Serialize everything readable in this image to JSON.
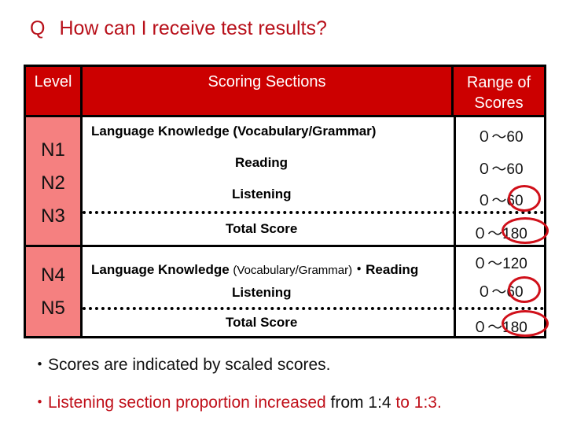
{
  "title": {
    "prefix": "Q",
    "text": "How can I receive test results?"
  },
  "table": {
    "headers": {
      "level": "Level",
      "sections": "Scoring Sections",
      "range_line1": "Range of",
      "range_line2": "Scores"
    },
    "groups": [
      {
        "levels": [
          "N1",
          "N2",
          "N3"
        ],
        "rows": [
          {
            "section": "Language Knowledge (Vocabulary/Grammar)",
            "range": "０～60",
            "circled": false
          },
          {
            "section": "Reading",
            "range": "０～60",
            "circled": false
          },
          {
            "section": "Listening",
            "range": "０～60",
            "circled": true
          },
          {
            "section": "Total Score",
            "range": "０～180",
            "circled": true
          }
        ]
      },
      {
        "levels": [
          "N4",
          "N5"
        ],
        "rows": [
          {
            "section_bold": "Language Knowledge",
            "section_small": "(Vocabulary/Grammar)",
            "section_tail": "・Reading",
            "range": "０～120",
            "circled": false
          },
          {
            "section": "Listening",
            "range": "０～60",
            "circled": true
          },
          {
            "section": "Total Score",
            "range": "０～180",
            "circled": true
          }
        ]
      }
    ]
  },
  "notes": [
    {
      "bullet": "・",
      "text": "Scores are indicated by scaled scores."
    },
    {
      "bullet": "・",
      "red_part": "Listening section proportion increased",
      "black_part": " from 1:4",
      "red_tail": " to 1:3."
    }
  ],
  "colors": {
    "header_bg": "#cc0000",
    "level_bg": "#f58080",
    "accent_red": "#c0101a"
  }
}
